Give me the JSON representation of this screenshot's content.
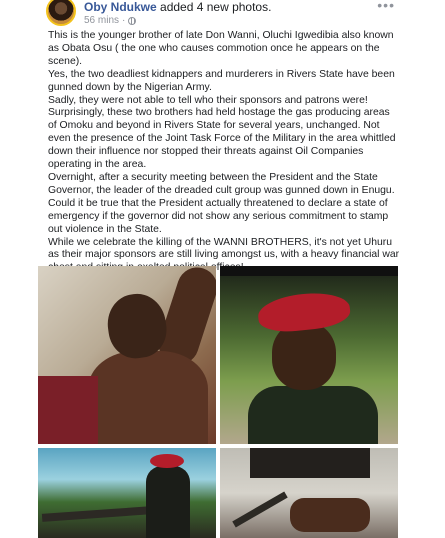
{
  "header": {
    "author": "Oby Ndukwe",
    "action": " added 4 new photos.",
    "time": "56 mins",
    "separator": "·"
  },
  "post": {
    "paragraphs": [
      "This is the younger brother of late Don Wanni,  Oluchi Igwedibia also known as Obata Osu ( the one who causes commotion once he appears on the scene).",
      "Yes, the two deadliest kidnappers and murderers in Rivers State have been gunned down by the Nigerian Army.",
      "Sadly, they were not able to tell who their sponsors and patrons were!",
      "Surprisingly, these two brothers had held hostage the gas producing areas of Omoku and beyond in Rivers State for several years, unchanged. Not even the presence of the Joint Task Force of the Military in the area whittled down their influence nor stopped their threats against Oil Companies operating in the area.",
      "Overnight, after a security meeting between the President and the State Governor, the leader of the dreaded cult group was gunned down in Enugu. Could it be true that the President actually threatened to declare a state of emergency if the governor did not show any serious commitment to stamp out violence in the State.",
      "While we celebrate the killing of the WANNI BROTHERS, it's not yet Uhuru as their major sponsors are still living amongst us, with a heavy financial war chest and sitting in exalted political offices!"
    ]
  },
  "icons": {
    "privacy": "globe-icon",
    "menu": "more-icon",
    "accent": "#385898"
  }
}
